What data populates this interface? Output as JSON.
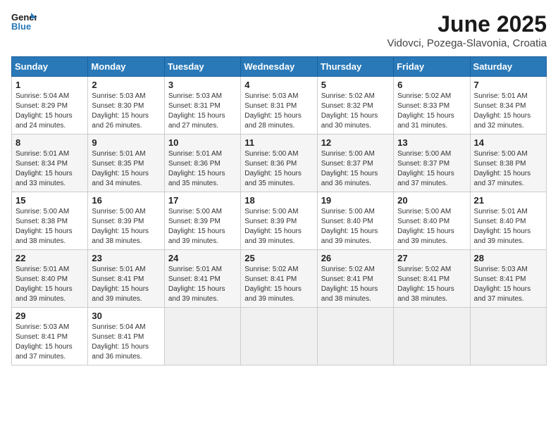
{
  "logo": {
    "line1": "General",
    "line2": "Blue"
  },
  "title": "June 2025",
  "subtitle": "Vidovci, Pozega-Slavonia, Croatia",
  "weekdays": [
    "Sunday",
    "Monday",
    "Tuesday",
    "Wednesday",
    "Thursday",
    "Friday",
    "Saturday"
  ],
  "weeks": [
    [
      {
        "day": "1",
        "info": "Sunrise: 5:04 AM\nSunset: 8:29 PM\nDaylight: 15 hours\nand 24 minutes."
      },
      {
        "day": "2",
        "info": "Sunrise: 5:03 AM\nSunset: 8:30 PM\nDaylight: 15 hours\nand 26 minutes."
      },
      {
        "day": "3",
        "info": "Sunrise: 5:03 AM\nSunset: 8:31 PM\nDaylight: 15 hours\nand 27 minutes."
      },
      {
        "day": "4",
        "info": "Sunrise: 5:03 AM\nSunset: 8:31 PM\nDaylight: 15 hours\nand 28 minutes."
      },
      {
        "day": "5",
        "info": "Sunrise: 5:02 AM\nSunset: 8:32 PM\nDaylight: 15 hours\nand 30 minutes."
      },
      {
        "day": "6",
        "info": "Sunrise: 5:02 AM\nSunset: 8:33 PM\nDaylight: 15 hours\nand 31 minutes."
      },
      {
        "day": "7",
        "info": "Sunrise: 5:01 AM\nSunset: 8:34 PM\nDaylight: 15 hours\nand 32 minutes."
      }
    ],
    [
      {
        "day": "8",
        "info": "Sunrise: 5:01 AM\nSunset: 8:34 PM\nDaylight: 15 hours\nand 33 minutes."
      },
      {
        "day": "9",
        "info": "Sunrise: 5:01 AM\nSunset: 8:35 PM\nDaylight: 15 hours\nand 34 minutes."
      },
      {
        "day": "10",
        "info": "Sunrise: 5:01 AM\nSunset: 8:36 PM\nDaylight: 15 hours\nand 35 minutes."
      },
      {
        "day": "11",
        "info": "Sunrise: 5:00 AM\nSunset: 8:36 PM\nDaylight: 15 hours\nand 35 minutes."
      },
      {
        "day": "12",
        "info": "Sunrise: 5:00 AM\nSunset: 8:37 PM\nDaylight: 15 hours\nand 36 minutes."
      },
      {
        "day": "13",
        "info": "Sunrise: 5:00 AM\nSunset: 8:37 PM\nDaylight: 15 hours\nand 37 minutes."
      },
      {
        "day": "14",
        "info": "Sunrise: 5:00 AM\nSunset: 8:38 PM\nDaylight: 15 hours\nand 37 minutes."
      }
    ],
    [
      {
        "day": "15",
        "info": "Sunrise: 5:00 AM\nSunset: 8:38 PM\nDaylight: 15 hours\nand 38 minutes."
      },
      {
        "day": "16",
        "info": "Sunrise: 5:00 AM\nSunset: 8:39 PM\nDaylight: 15 hours\nand 38 minutes."
      },
      {
        "day": "17",
        "info": "Sunrise: 5:00 AM\nSunset: 8:39 PM\nDaylight: 15 hours\nand 39 minutes."
      },
      {
        "day": "18",
        "info": "Sunrise: 5:00 AM\nSunset: 8:39 PM\nDaylight: 15 hours\nand 39 minutes."
      },
      {
        "day": "19",
        "info": "Sunrise: 5:00 AM\nSunset: 8:40 PM\nDaylight: 15 hours\nand 39 minutes."
      },
      {
        "day": "20",
        "info": "Sunrise: 5:00 AM\nSunset: 8:40 PM\nDaylight: 15 hours\nand 39 minutes."
      },
      {
        "day": "21",
        "info": "Sunrise: 5:01 AM\nSunset: 8:40 PM\nDaylight: 15 hours\nand 39 minutes."
      }
    ],
    [
      {
        "day": "22",
        "info": "Sunrise: 5:01 AM\nSunset: 8:40 PM\nDaylight: 15 hours\nand 39 minutes."
      },
      {
        "day": "23",
        "info": "Sunrise: 5:01 AM\nSunset: 8:41 PM\nDaylight: 15 hours\nand 39 minutes."
      },
      {
        "day": "24",
        "info": "Sunrise: 5:01 AM\nSunset: 8:41 PM\nDaylight: 15 hours\nand 39 minutes."
      },
      {
        "day": "25",
        "info": "Sunrise: 5:02 AM\nSunset: 8:41 PM\nDaylight: 15 hours\nand 39 minutes."
      },
      {
        "day": "26",
        "info": "Sunrise: 5:02 AM\nSunset: 8:41 PM\nDaylight: 15 hours\nand 38 minutes."
      },
      {
        "day": "27",
        "info": "Sunrise: 5:02 AM\nSunset: 8:41 PM\nDaylight: 15 hours\nand 38 minutes."
      },
      {
        "day": "28",
        "info": "Sunrise: 5:03 AM\nSunset: 8:41 PM\nDaylight: 15 hours\nand 37 minutes."
      }
    ],
    [
      {
        "day": "29",
        "info": "Sunrise: 5:03 AM\nSunset: 8:41 PM\nDaylight: 15 hours\nand 37 minutes."
      },
      {
        "day": "30",
        "info": "Sunrise: 5:04 AM\nSunset: 8:41 PM\nDaylight: 15 hours\nand 36 minutes."
      },
      null,
      null,
      null,
      null,
      null
    ]
  ]
}
